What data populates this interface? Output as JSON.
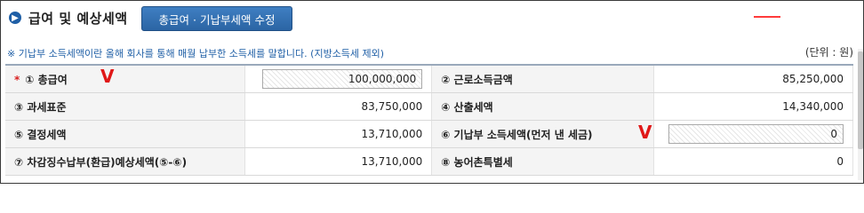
{
  "header": {
    "title": "급여 및 예상세액",
    "edit_button": "총급여 · 기납부세액 수정"
  },
  "note": "※ 기납부 소득세액이란 올해 회사를 통해 매월 납부한 소득세를 말합니다. (지방소득세 제외)",
  "unit": "(단위 : 원)",
  "rows": [
    {
      "l_label": "① 총급여",
      "l_value": "100,000,000",
      "r_label": "② 근로소득금액",
      "r_value": "85,250,000"
    },
    {
      "l_label": "③ 과세표준",
      "l_value": "83,750,000",
      "r_label": "④ 산출세액",
      "r_value": "14,340,000"
    },
    {
      "l_label": "⑤ 결정세액",
      "l_value": "13,710,000",
      "r_label": "⑥ 기납부 소득세액(먼저 낸 세금)",
      "r_value": "0"
    },
    {
      "l_label": "⑦ 차감징수납부(환급)예상세액(⑤-⑥)",
      "l_value": "13,710,000",
      "r_label": "⑧ 농어촌특별세",
      "r_value": "0"
    }
  ],
  "marks": {
    "v1": "V",
    "v2": "V"
  },
  "required_star": "*",
  "colors": {
    "accent": "#1f5fa6",
    "button": "#2b65a4",
    "annotation": "#e01818"
  },
  "icons": {
    "header_bullet": "arrow-circle-icon"
  }
}
